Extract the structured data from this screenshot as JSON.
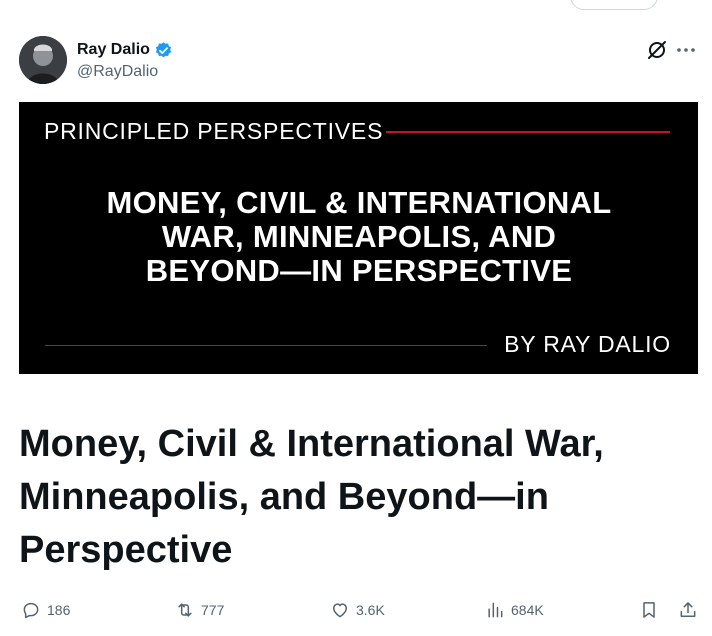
{
  "author": {
    "name": "Ray Dalio",
    "handle": "@RayDalio",
    "verified": true
  },
  "header_icons": [
    "grok-icon",
    "more-icon"
  ],
  "banner": {
    "kicker": "PRINCIPLED PERSPECTIVES",
    "title_lines": [
      "MONEY, CIVIL & INTERNATIONAL",
      "WAR, MINNEAPOLIS, AND",
      "BEYOND—IN PERSPECTIVE"
    ],
    "byline": "BY RAY DALIO"
  },
  "article": {
    "title": "Money, Civil & International War, Minneapolis, and Beyond—in Perspective"
  },
  "actions": {
    "replies": "186",
    "reposts": "777",
    "likes": "3.6K",
    "views": "684K"
  },
  "colors": {
    "text_primary": "#0f1419",
    "text_secondary": "#536471",
    "verified_blue": "#1d9bf0",
    "banner_rule_red": "#c8102e",
    "banner_bg": "#000000"
  }
}
